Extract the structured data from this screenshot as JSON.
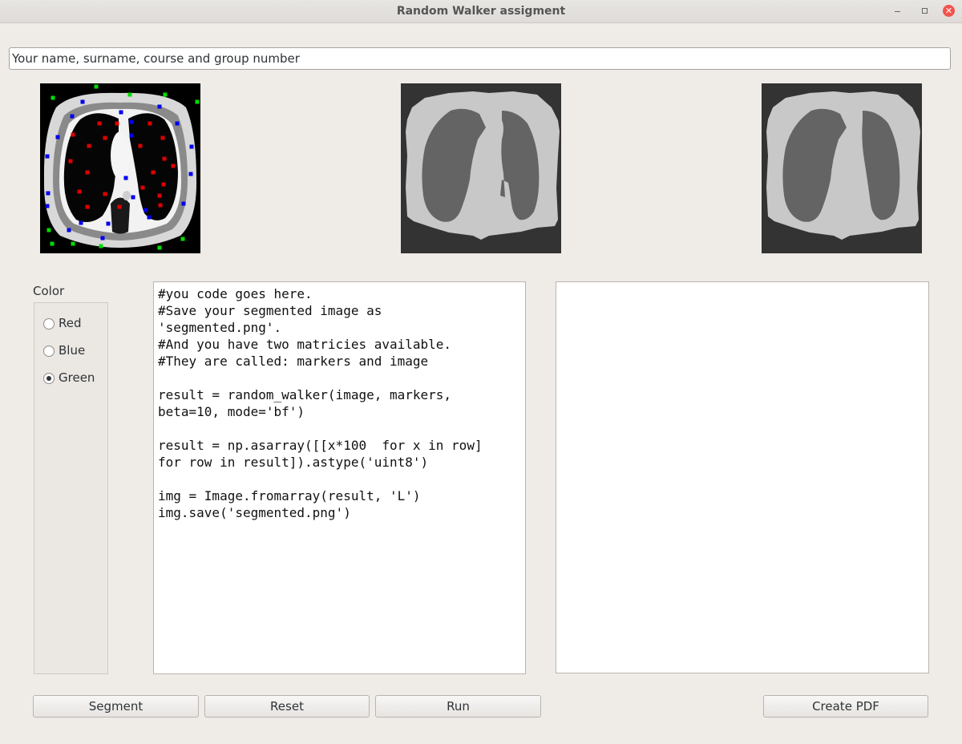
{
  "window": {
    "title": "Random Walker assigment"
  },
  "name_field": {
    "value": "Your name, surname, course and group number"
  },
  "color_panel": {
    "label": "Color",
    "options": [
      {
        "label": "Red",
        "checked": false
      },
      {
        "label": "Blue",
        "checked": false
      },
      {
        "label": "Green",
        "checked": true
      }
    ]
  },
  "code_editor": {
    "text": "#you code goes here.\n#Save your segmented image as\n'segmented.png'.\n#And you have two matricies available.\n#They are called: markers and image\n\nresult = random_walker(image, markers,\nbeta=10, mode='bf')\n\nresult = np.asarray([[x*100  for x in row]\nfor row in result]).astype('uint8')\n\nimg = Image.fromarray(result, 'L')\nimg.save('segmented.png')"
  },
  "output_panel": {
    "text": ""
  },
  "buttons": {
    "segment": "Segment",
    "reset": "Reset",
    "run": "Run",
    "create_pdf": "Create PDF"
  },
  "colors": {
    "marker_red": "#e00000",
    "marker_blue": "#0000ee",
    "marker_green": "#00dd00",
    "segment_dark": "#646464",
    "segment_light": "#c8c8c8",
    "background_dark": "#333333"
  }
}
